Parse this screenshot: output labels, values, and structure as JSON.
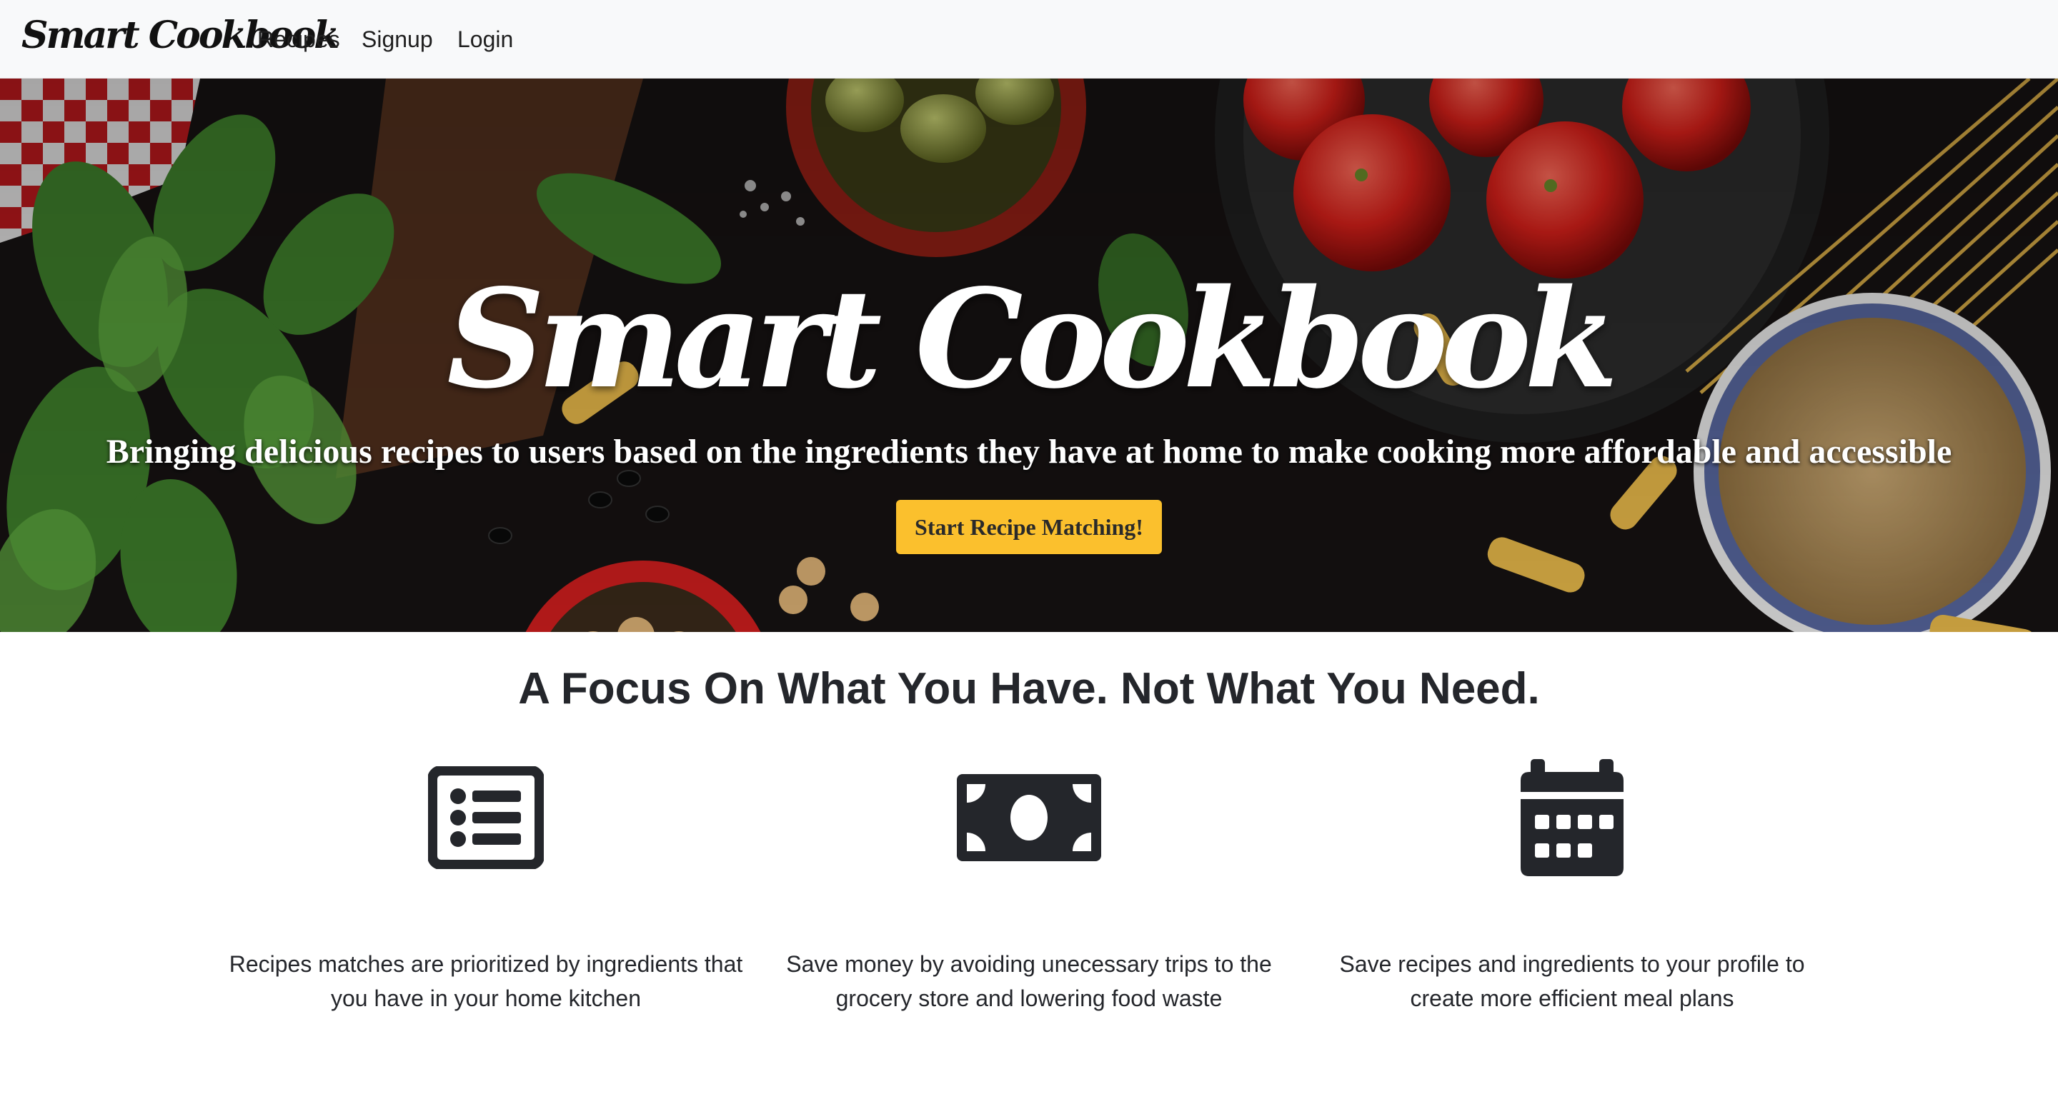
{
  "navbar": {
    "brand": "Smart Cookbook",
    "links": [
      "Recipes",
      "Signup",
      "Login"
    ]
  },
  "hero": {
    "title": "Smart Cookbook",
    "subtitle": "Bringing delicious recipes to users based on the ingredients they have at home to make cooking more affordable and accessible",
    "cta": "Start Recipe Matching!"
  },
  "features": {
    "heading": "A Focus On What You Have. Not What You Need.",
    "items": [
      {
        "icon": "list-icon",
        "text": "Recipes matches are prioritized by ingredients that you have in your home kitchen"
      },
      {
        "icon": "money-icon",
        "text": "Save money by avoiding unecessary trips to the grocery store and lowering food waste"
      },
      {
        "icon": "calendar-icon",
        "text": "Save recipes and ingredients to your profile to create more efficient meal plans"
      }
    ]
  },
  "colors": {
    "navbar_bg": "#f8f9fa",
    "cta_bg": "#fbc02d",
    "icon": "#24262b",
    "hero_bg": "#121010"
  }
}
